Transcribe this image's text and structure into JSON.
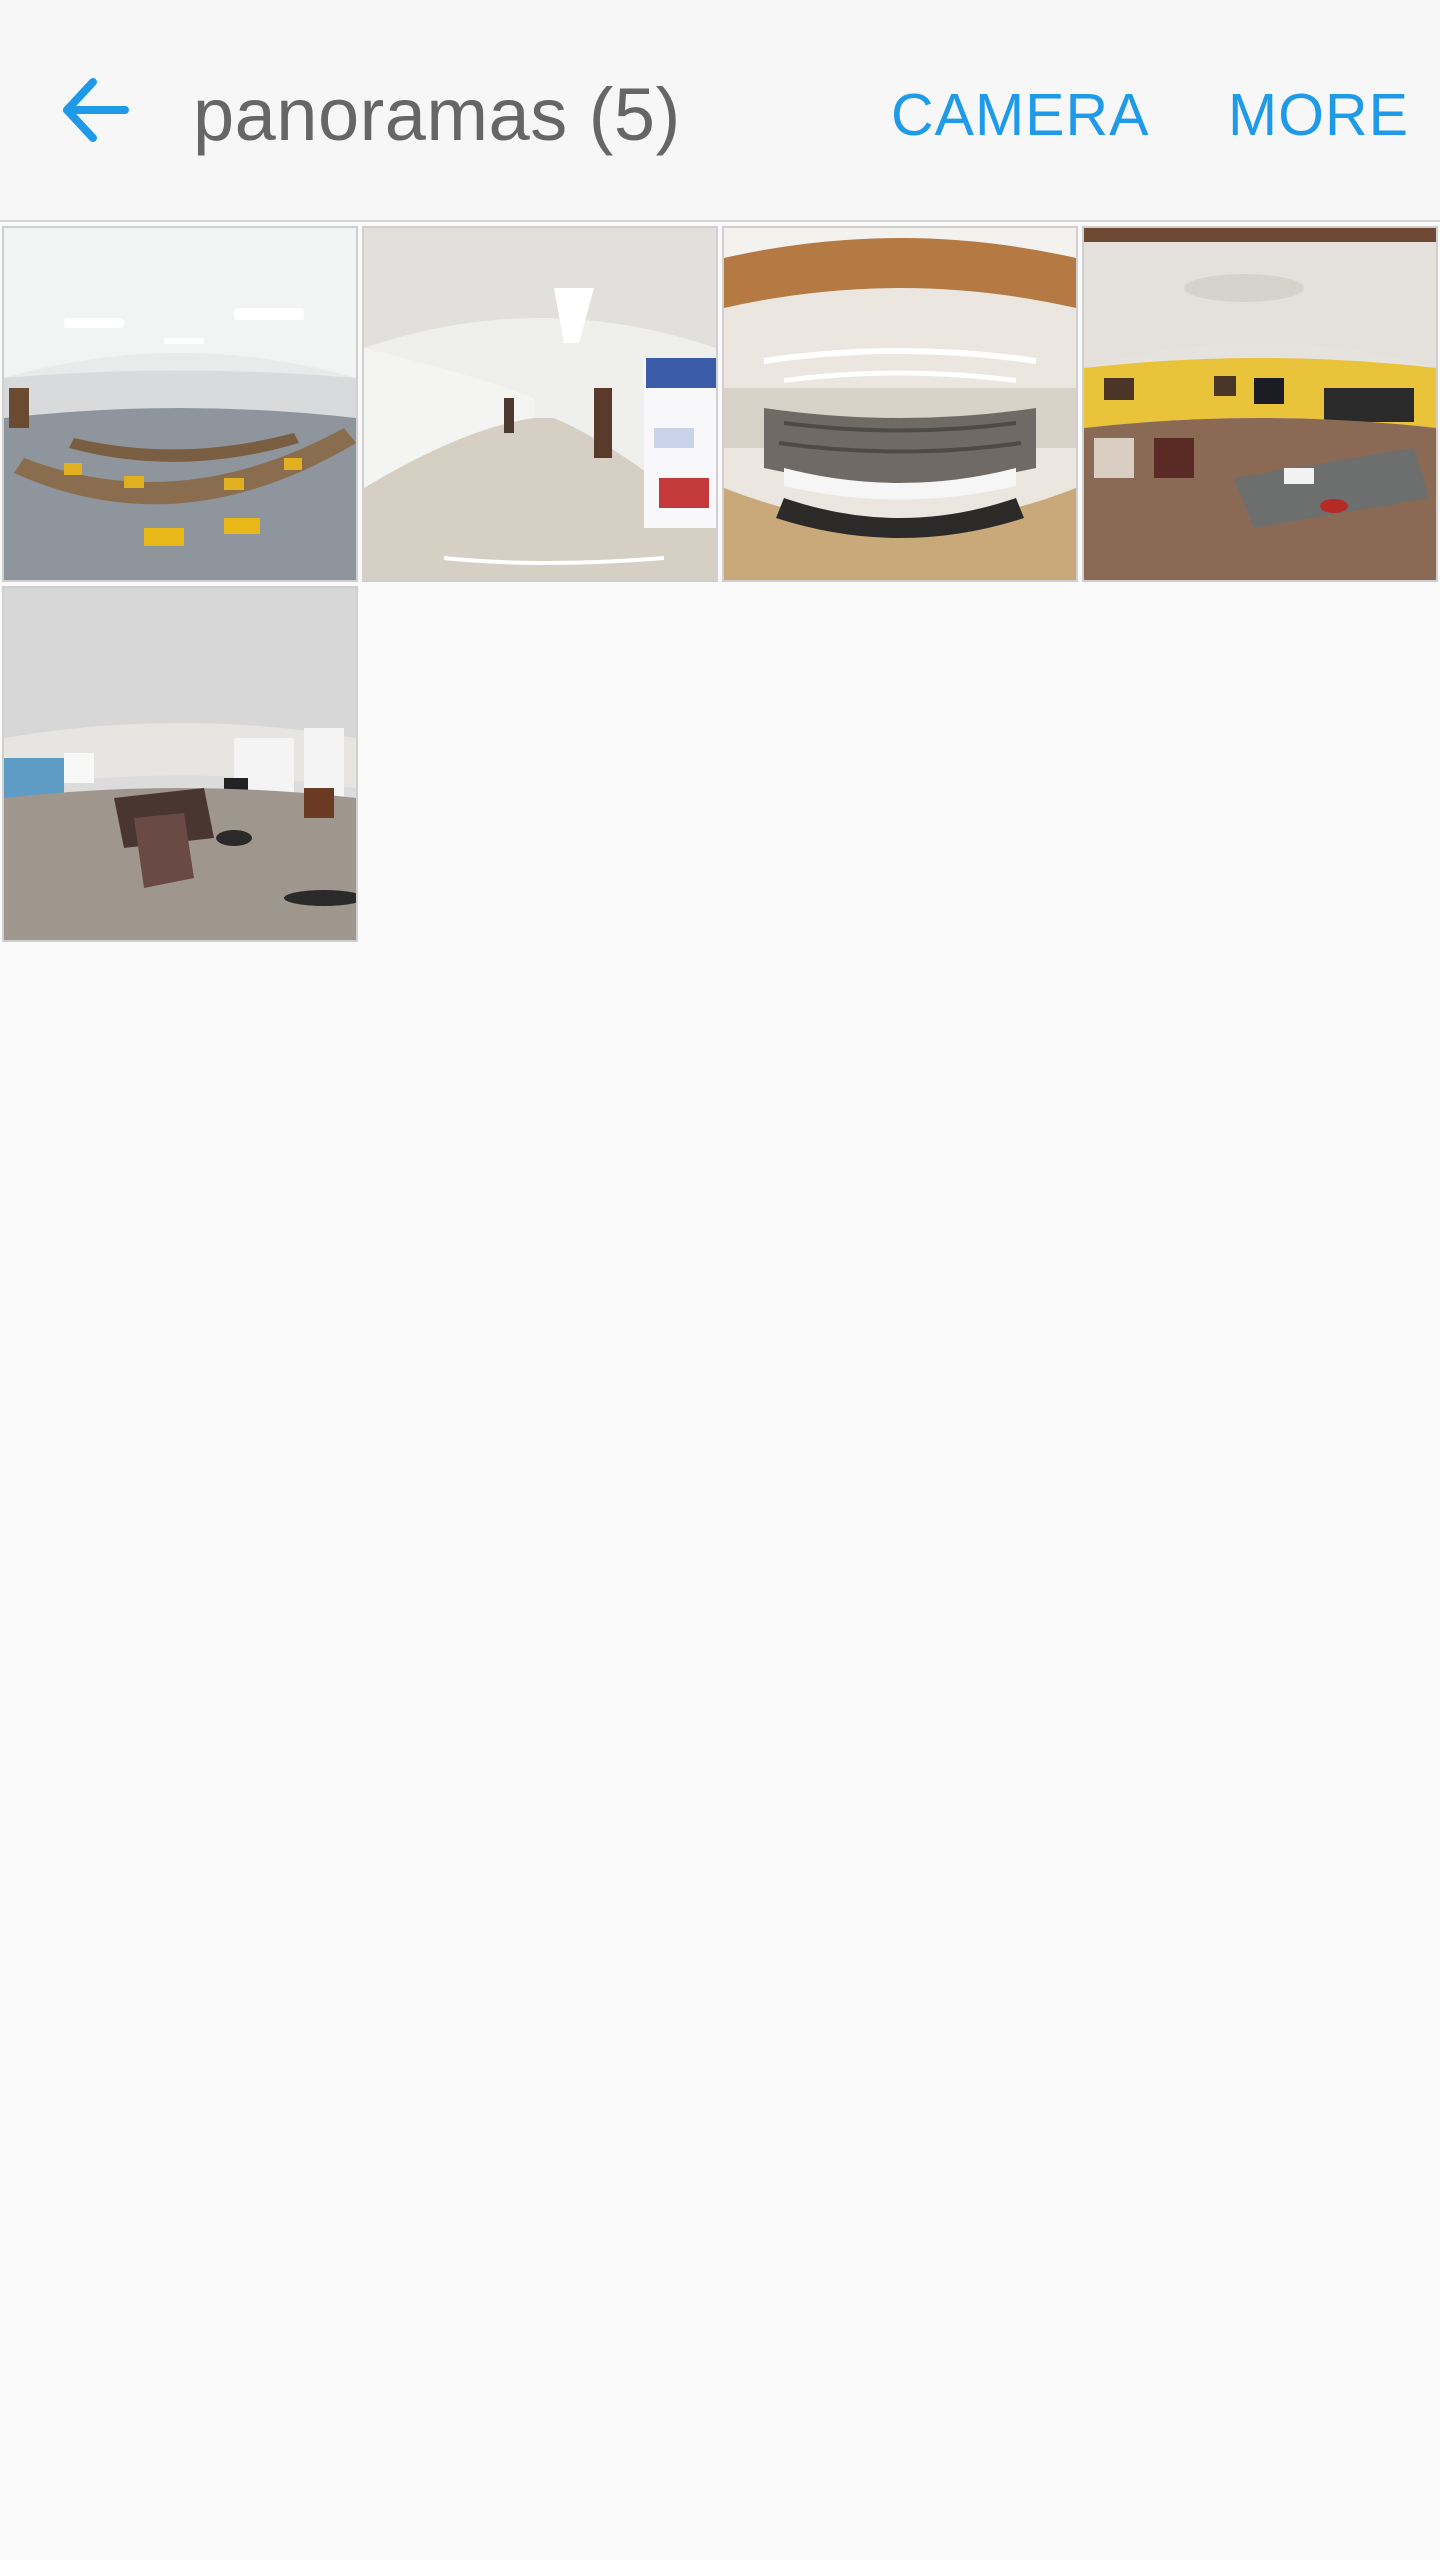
{
  "app_bar": {
    "back_icon": "arrow-left-icon",
    "title": "panoramas (5)",
    "camera_label": "CAMERA",
    "more_label": "MORE",
    "accent_color": "#1f9ae8",
    "title_color": "#666666"
  },
  "gallery": {
    "count": 5,
    "items": [
      {
        "icon": "panorama-thumbnail",
        "scene": "conference room"
      },
      {
        "icon": "panorama-thumbnail",
        "scene": "hallway"
      },
      {
        "icon": "panorama-thumbnail",
        "scene": "lecture hall"
      },
      {
        "icon": "panorama-thumbnail",
        "scene": "lounge"
      },
      {
        "icon": "panorama-thumbnail",
        "scene": "living room"
      }
    ]
  }
}
